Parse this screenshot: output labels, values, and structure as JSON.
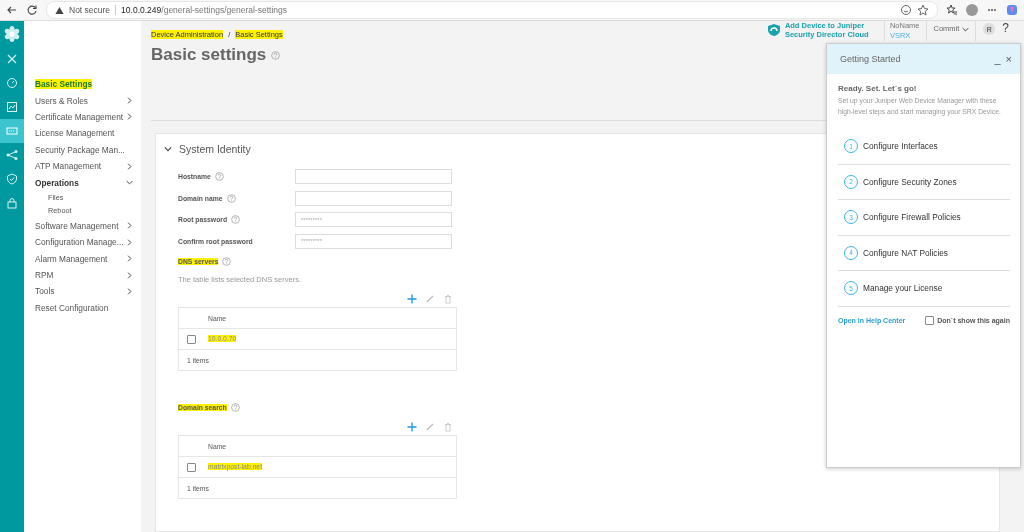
{
  "browser": {
    "security": "Not secure",
    "url_host": "10.0.0.249",
    "url_path": "/general-settings/general-settings"
  },
  "sidebar": {
    "items": [
      {
        "label": "Basic Settings",
        "kind": "link",
        "selected": true,
        "highlighted": true
      },
      {
        "label": "Users & Roles",
        "kind": "group",
        "expanded": false,
        "selected": false,
        "highlighted": false
      },
      {
        "label": "Certificate Management",
        "kind": "group",
        "expanded": false,
        "selected": false,
        "highlighted": false
      },
      {
        "label": "License Management",
        "kind": "link",
        "selected": false,
        "highlighted": false
      },
      {
        "label": "Security Package Man...",
        "kind": "link",
        "selected": false,
        "highlighted": false
      },
      {
        "label": "ATP Management",
        "kind": "group",
        "expanded": false,
        "selected": false,
        "highlighted": false
      },
      {
        "label": "Operations",
        "kind": "group",
        "expanded": true,
        "selected": false,
        "highlighted": false,
        "children": [
          {
            "label": "Files"
          },
          {
            "label": "Reboot"
          }
        ]
      },
      {
        "label": "Software Management",
        "kind": "group",
        "expanded": false,
        "selected": false,
        "highlighted": false
      },
      {
        "label": "Configuration Manage...",
        "kind": "group",
        "expanded": false,
        "selected": false,
        "highlighted": false
      },
      {
        "label": "Alarm Management",
        "kind": "group",
        "expanded": false,
        "selected": false,
        "highlighted": false
      },
      {
        "label": "RPM",
        "kind": "group",
        "expanded": false,
        "selected": false,
        "highlighted": false
      },
      {
        "label": "Tools",
        "kind": "group",
        "expanded": false,
        "selected": false,
        "highlighted": false
      },
      {
        "label": "Reset Configuration",
        "kind": "link",
        "selected": false,
        "highlighted": false
      }
    ]
  },
  "header": {
    "cloud_link": "Add Device to Juniper Security Director Cloud",
    "device_name": "NoName",
    "device_model": "VSRX",
    "commit": "Commit",
    "avatar": "R",
    "help": "?"
  },
  "breadcrumb": [
    {
      "label": "Device Administration",
      "highlighted": true
    },
    {
      "label": "Basic Settings",
      "highlighted": true
    }
  ],
  "breadcrumb_separator": "/",
  "page_title": "Basic settings",
  "section": {
    "title": "System Identity",
    "expanded": true,
    "fields": [
      {
        "label": "Hostname",
        "help": true
      },
      {
        "label": "Domain name",
        "help": true
      },
      {
        "label": "Root password",
        "help": true,
        "placeholder": "*********"
      },
      {
        "label": "Confirm root password",
        "help": false,
        "placeholder": "*********"
      }
    ],
    "tables": [
      {
        "title": "DNS servers",
        "highlighted": true,
        "description": "The table lists selected DNS servers.",
        "column": "Name",
        "rows": [
          {
            "value": "10.0.0.70",
            "checked": false,
            "highlighted": true
          }
        ],
        "footer": "1 items"
      },
      {
        "title": "Domain search",
        "highlighted": true,
        "column": "Name",
        "rows": [
          {
            "value": "matrixpost-lab.net",
            "checked": false,
            "highlighted": true
          }
        ],
        "footer": "1 items"
      }
    ]
  },
  "getting_started": {
    "title": "Getting Started",
    "minimize": "_",
    "close": "×",
    "heading": "Ready. Set. Let`s go!",
    "intro": "Set up your Juniper Web Device Manager with these high-level steps and start managing your SRX Device.",
    "steps": [
      {
        "number": "1",
        "label": "Configure Interfaces"
      },
      {
        "number": "2",
        "label": "Configure Security Zones"
      },
      {
        "number": "3",
        "label": "Configure Firewall Policies"
      },
      {
        "number": "4",
        "label": "Configure NAT Policies"
      },
      {
        "number": "5",
        "label": "Manage your License"
      }
    ],
    "help_link": "Open in Help Center",
    "dont_show": {
      "label": "Don`t show this again",
      "checked": false
    }
  }
}
